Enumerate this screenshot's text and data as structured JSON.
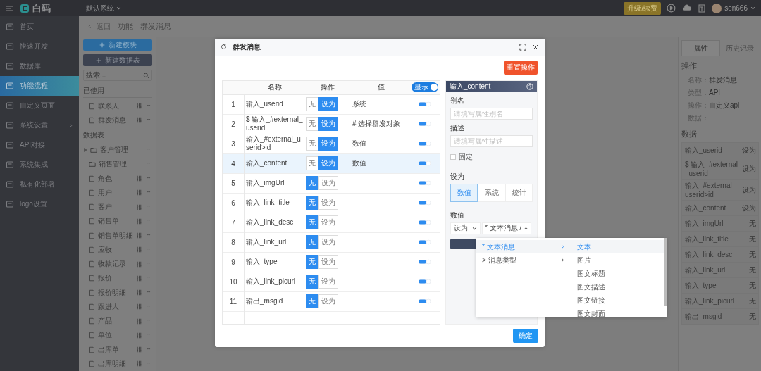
{
  "topbar": {
    "logo": "白码",
    "system": "默认系统",
    "upgrade": "升级/续费",
    "user": "sen666"
  },
  "sidebar": {
    "items": [
      {
        "label": "首页",
        "selected": false,
        "expandable": false
      },
      {
        "label": "快速开发",
        "selected": false,
        "expandable": false
      },
      {
        "label": "数据库",
        "selected": false,
        "expandable": false
      },
      {
        "label": "功能流程",
        "selected": true,
        "expandable": false
      },
      {
        "label": "自定义页面",
        "selected": false,
        "expandable": false
      },
      {
        "label": "系统设置",
        "selected": false,
        "expandable": true
      },
      {
        "label": "API对接",
        "selected": false,
        "expandable": false
      },
      {
        "label": "系统集成",
        "selected": false,
        "expandable": false
      },
      {
        "label": "私有化部署",
        "selected": false,
        "expandable": false
      },
      {
        "label": "logo设置",
        "selected": false,
        "expandable": false
      }
    ]
  },
  "breadcrumb": {
    "back": "返回",
    "path": "功能 - 群发消息"
  },
  "modules": {
    "new_module": "新建模块",
    "new_table": "新建数据表",
    "search_placeholder": "搜索...",
    "sections": [
      {
        "title": "已使用",
        "items": [
          {
            "label": "联系人",
            "kind": "file"
          },
          {
            "label": "群发消息",
            "kind": "file"
          }
        ]
      },
      {
        "title": "数据表",
        "items": [
          {
            "label": "客户管理",
            "kind": "group"
          },
          {
            "label": "销售管理",
            "kind": "folder"
          },
          {
            "label": "角色",
            "kind": "file"
          },
          {
            "label": "用户",
            "kind": "file"
          },
          {
            "label": "客户",
            "kind": "file"
          },
          {
            "label": "销售单",
            "kind": "file"
          },
          {
            "label": "销售单明细",
            "kind": "file"
          },
          {
            "label": "应收",
            "kind": "file"
          },
          {
            "label": "收款记录",
            "kind": "file"
          },
          {
            "label": "报价",
            "kind": "file"
          },
          {
            "label": "报价明细",
            "kind": "file"
          },
          {
            "label": "跟进人",
            "kind": "file"
          },
          {
            "label": "产品",
            "kind": "file"
          },
          {
            "label": "单位",
            "kind": "file"
          },
          {
            "label": "出库单",
            "kind": "file"
          },
          {
            "label": "出库明细",
            "kind": "file"
          }
        ]
      }
    ]
  },
  "properties": {
    "tabs": [
      {
        "label": "属性",
        "selected": true
      },
      {
        "label": "历史记录",
        "selected": false
      }
    ],
    "op_title": "操作",
    "props": [
      {
        "label": "名称：",
        "value": "群发消息"
      },
      {
        "label": "类型：",
        "value": "API"
      },
      {
        "label": "操作：",
        "value": "自定义api"
      },
      {
        "label": "数据："
      }
    ],
    "data_title": "数据",
    "data_rows": [
      {
        "name": "输入_userid",
        "value": "设为"
      },
      {
        "name": "$ 输入_#external_userid",
        "value": "设为"
      },
      {
        "name": "输入_#external_userid>id",
        "value": "设为"
      },
      {
        "name": "输入_content",
        "value": "设为"
      },
      {
        "name": "输入_imgUrl",
        "value": "无"
      },
      {
        "name": "输入_link_title",
        "value": "无"
      },
      {
        "name": "输入_link_desc",
        "value": "无"
      },
      {
        "name": "输入_link_url",
        "value": "无"
      },
      {
        "name": "输入_type",
        "value": "无"
      },
      {
        "name": "输入_link_picurl",
        "value": "无"
      },
      {
        "name": "输出_msgid",
        "value": "无"
      }
    ]
  },
  "modal": {
    "title": "群发消息",
    "reset": "重置操作",
    "columns": [
      "名称",
      "操作",
      "值"
    ],
    "show_toggle": {
      "label": "显示",
      "on": true
    },
    "rows": [
      {
        "no": "1",
        "name": "输入_userid",
        "ops": [
          {
            "label": "无",
            "selected": false
          },
          {
            "label": "设为",
            "selected": true
          }
        ],
        "value": "系统",
        "shown": true,
        "selected": false
      },
      {
        "no": "2",
        "name": "$ 输入_#external_userid",
        "ops": [
          {
            "label": "无",
            "selected": false
          },
          {
            "label": "设为",
            "selected": true
          }
        ],
        "value": "# 选择群发对象",
        "shown": true,
        "selected": false
      },
      {
        "no": "3",
        "name": "输入_#external_userid>id",
        "ops": [
          {
            "label": "无",
            "selected": false
          },
          {
            "label": "设为",
            "selected": true
          }
        ],
        "value": "数值",
        "shown": true,
        "selected": false
      },
      {
        "no": "4",
        "name": "输入_content",
        "ops": [
          {
            "label": "无",
            "selected": false
          },
          {
            "label": "设为",
            "selected": true
          }
        ],
        "value": "数值",
        "shown": true,
        "selected": true
      },
      {
        "no": "5",
        "name": "输入_imgUrl",
        "ops": [
          {
            "label": "无",
            "selected": true
          },
          {
            "label": "设为",
            "selected": false
          }
        ],
        "shown": true,
        "selected": false
      },
      {
        "no": "6",
        "name": "输入_link_title",
        "ops": [
          {
            "label": "无",
            "selected": true
          },
          {
            "label": "设为",
            "selected": false
          }
        ],
        "shown": true,
        "selected": false
      },
      {
        "no": "7",
        "name": "输入_link_desc",
        "ops": [
          {
            "label": "无",
            "selected": true
          },
          {
            "label": "设为",
            "selected": false
          }
        ],
        "shown": true,
        "selected": false
      },
      {
        "no": "8",
        "name": "输入_link_url",
        "ops": [
          {
            "label": "无",
            "selected": true
          },
          {
            "label": "设为",
            "selected": false
          }
        ],
        "shown": true,
        "selected": false
      },
      {
        "no": "9",
        "name": "输入_type",
        "ops": [
          {
            "label": "无",
            "selected": true
          },
          {
            "label": "设为",
            "selected": false
          }
        ],
        "shown": true,
        "selected": false
      },
      {
        "no": "10",
        "name": "输入_link_picurl",
        "ops": [
          {
            "label": "无",
            "selected": true
          },
          {
            "label": "设为",
            "selected": false
          }
        ],
        "shown": true,
        "selected": false
      },
      {
        "no": "11",
        "name": "输出_msgid",
        "ops": [
          {
            "label": "无",
            "selected": true
          },
          {
            "label": "设为",
            "selected": false
          }
        ],
        "shown": true,
        "selected": false
      }
    ],
    "editor": {
      "title": "输入_content",
      "alias_label": "别名",
      "alias_placeholder": "请填写属性别名",
      "desc_label": "描述",
      "desc_placeholder": "请填写属性描述",
      "fixed": {
        "label": "固定",
        "checked": false
      },
      "set_label": "设为",
      "set_options": [
        {
          "label": "数值",
          "selected": true
        },
        {
          "label": "系统",
          "selected": false
        },
        {
          "label": "统计",
          "selected": false
        }
      ],
      "value_label": "数值",
      "mode": "设为",
      "cascade_value": "* 文本消息 /"
    },
    "confirm": "确定"
  },
  "cascader": {
    "level1": [
      {
        "label": "* 文本消息",
        "selected": true
      },
      {
        "label": "> 消息类型",
        "selected": false
      }
    ],
    "level2": [
      {
        "label": "文本",
        "selected": true
      },
      {
        "label": "图片",
        "selected": false
      },
      {
        "label": "图文标题",
        "selected": false
      },
      {
        "label": "图文描述",
        "selected": false
      },
      {
        "label": "图文链接",
        "selected": false
      },
      {
        "label": "图文封面",
        "selected": false
      }
    ]
  }
}
